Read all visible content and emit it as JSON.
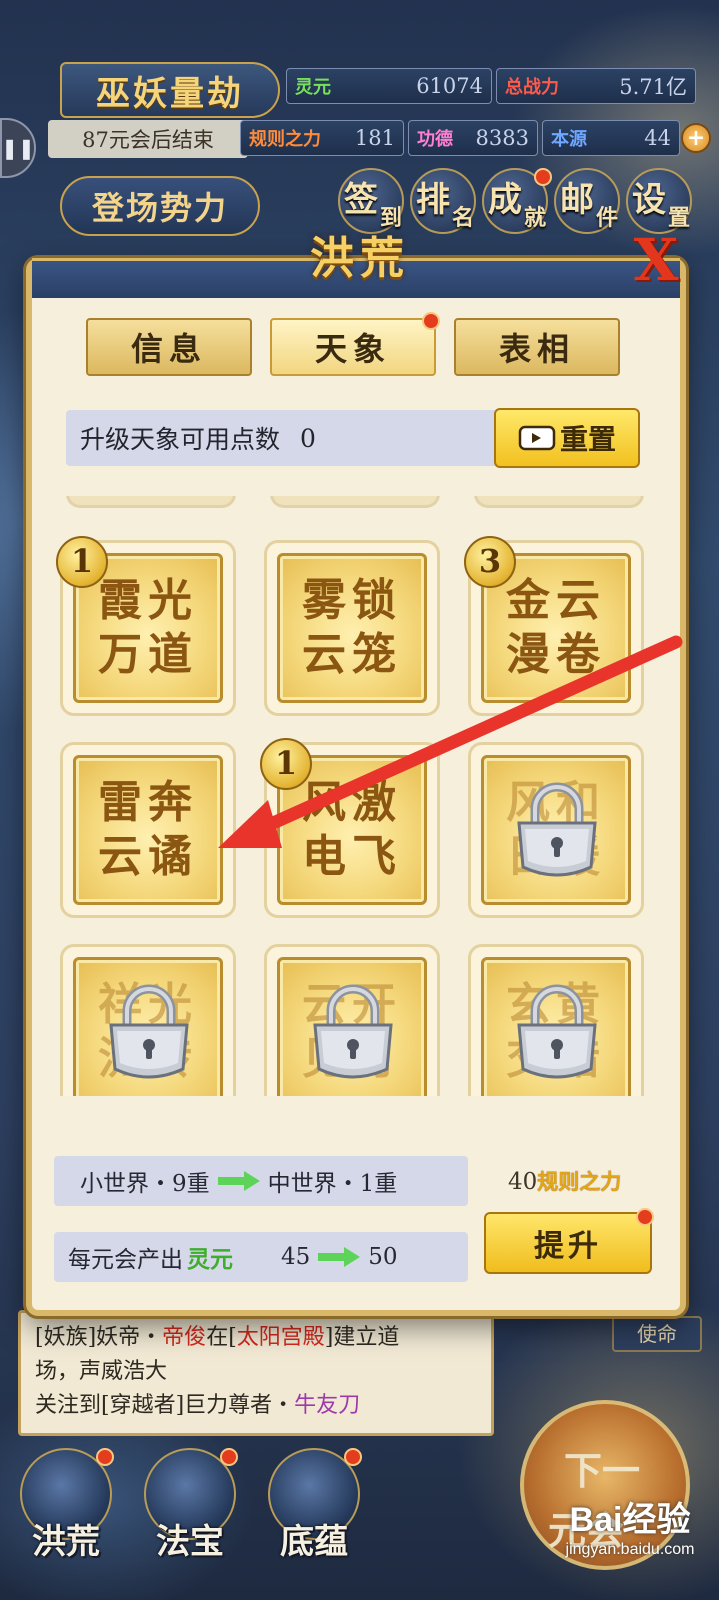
{
  "hud": {
    "game_title": "巫妖量劫",
    "countdown": "87元会后结束",
    "faction_button": "登场势力",
    "resources": [
      {
        "label": "灵元",
        "value": "61074"
      },
      {
        "label": "总战力",
        "value": "5.71亿"
      },
      {
        "label": "规则之力",
        "value": "181"
      },
      {
        "label": "功德",
        "value": "8383"
      },
      {
        "label": "本源",
        "value": "44"
      }
    ],
    "menu": [
      {
        "big": "签",
        "small": "到"
      },
      {
        "big": "排",
        "small": "名"
      },
      {
        "big": "成",
        "small": "就"
      },
      {
        "big": "邮",
        "small": "件"
      },
      {
        "big": "设",
        "small": "置"
      }
    ]
  },
  "modal": {
    "title": "洪荒",
    "close_glyph": "X",
    "tabs": [
      "信息",
      "天象",
      "表相"
    ],
    "active_tab": "天象",
    "points_label": "升级天象可用点数",
    "points_value": "0",
    "reset_label": "重置",
    "cards": [
      {
        "name_line1": "霞光",
        "name_line2": "万道",
        "level": "1",
        "locked": false
      },
      {
        "name_line1": "雾锁",
        "name_line2": "云笼",
        "level": "",
        "locked": false
      },
      {
        "name_line1": "金云",
        "name_line2": "漫卷",
        "level": "3",
        "locked": false
      },
      {
        "name_line1": "雷奔",
        "name_line2": "云谲",
        "level": "",
        "locked": false
      },
      {
        "name_line1": "风激",
        "name_line2": "电飞",
        "level": "1",
        "locked": false
      },
      {
        "name_line1": "风和",
        "name_line2": "日暖",
        "level": "",
        "locked": true
      },
      {
        "name_line1": "祥光",
        "name_line2": "流转",
        "level": "",
        "locked": true
      },
      {
        "name_line1": "云开",
        "name_line2": "见月",
        "level": "",
        "locked": true
      },
      {
        "name_line1": "玄黄",
        "name_line2": "交错",
        "level": "",
        "locked": true
      }
    ],
    "world_from": "小世界・9重",
    "world_to": "中世界・1重",
    "output_label": "每元会产出",
    "output_resource": "灵元",
    "output_from": "45",
    "output_to": "50",
    "cost_amount": "40",
    "cost_resource": "规则之力",
    "upgrade_label": "提升"
  },
  "log": {
    "line1_a": "[妖族]妖帝・",
    "line1_b": "帝俊",
    "line1_c": "在[",
    "line1_d": "太阳宫殿",
    "line1_e": "]建立道",
    "line2": "场，声威浩大",
    "line3_a": "关注到[穿越者]巨力尊者・",
    "line3_b": "牛友刀",
    "mission_tab": "使命"
  },
  "bottom_nav": [
    {
      "label": "洪荒"
    },
    {
      "label": "法宝"
    },
    {
      "label": "底蕴"
    }
  ],
  "next_button": {
    "line1": "下一",
    "line2": "元会"
  },
  "watermark": {
    "main": "Bai经验",
    "sub": "jingyan.baidu.com"
  },
  "colors": {
    "accent_gold": "#f2c11f",
    "danger_red": "#e3361c",
    "arrow_red": "#e8342a",
    "arrow_green": "#5ed35a"
  }
}
